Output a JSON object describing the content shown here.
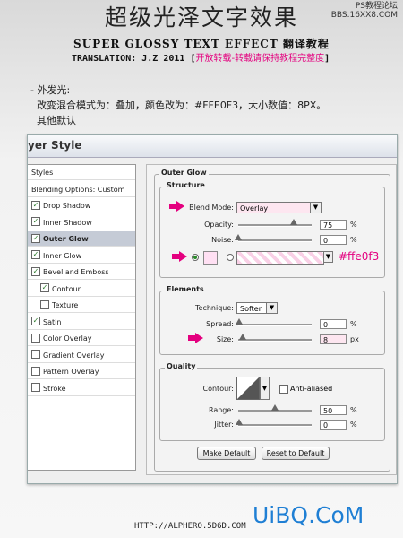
{
  "header": {
    "title": "超级光泽文字效果",
    "subtitle": "SUPER GLOSSY TEXT EFFECT 翻译教程",
    "translation_prefix": "TRANSLATION: J.Z  2011 [",
    "translation_note": "开放转载-转载请保持教程完整度",
    "translation_suffix": "]",
    "watermark": "PS教程论坛\nBBS.16XX8.COM"
  },
  "notes": {
    "line1": "- 外发光:",
    "line2": "  改变混合模式为：叠加，颜色改为：#FFE0F3，大小数值：8PX。",
    "line3": "  其他默认"
  },
  "dialog": {
    "title": "yer Style",
    "left_items": [
      {
        "label": "Styles",
        "checkbox": false
      },
      {
        "label": "Blending Options: Custom",
        "checkbox": false
      },
      {
        "label": "Drop Shadow",
        "checkbox": true,
        "checked": true
      },
      {
        "label": "Inner Shadow",
        "checkbox": true,
        "checked": true
      },
      {
        "label": "Outer Glow",
        "checkbox": true,
        "checked": true,
        "selected": true
      },
      {
        "label": "Inner Glow",
        "checkbox": true,
        "checked": true
      },
      {
        "label": "Bevel and Emboss",
        "checkbox": true,
        "checked": true
      },
      {
        "label": "Contour",
        "checkbox": true,
        "checked": true,
        "indent": true
      },
      {
        "label": "Texture",
        "checkbox": true,
        "checked": false,
        "indent": true
      },
      {
        "label": "Satin",
        "checkbox": true,
        "checked": true
      },
      {
        "label": "Color Overlay",
        "checkbox": true,
        "checked": false
      },
      {
        "label": "Gradient Overlay",
        "checkbox": true,
        "checked": false
      },
      {
        "label": "Pattern Overlay",
        "checkbox": true,
        "checked": false
      },
      {
        "label": "Stroke",
        "checkbox": true,
        "checked": false
      }
    ],
    "panel_title": "Outer Glow",
    "structure": {
      "label": "Structure",
      "blend_mode_label": "Blend Mode:",
      "blend_mode_value": "Overlay",
      "opacity_label": "Opacity:",
      "opacity_value": "75",
      "opacity_level": 0.75,
      "noise_label": "Noise:",
      "noise_value": "0",
      "noise_level": 0,
      "percent": "%",
      "color_hex": "#ffe0f3",
      "color_swatch": "#ffe0f3"
    },
    "elements": {
      "label": "Elements",
      "technique_label": "Technique:",
      "technique_value": "Softer",
      "spread_label": "Spread:",
      "spread_value": "0",
      "size_label": "Size:",
      "size_value": "8",
      "px": "px"
    },
    "quality": {
      "label": "Quality",
      "contour_label": "Contour:",
      "anti_aliased_label": "Anti-aliased",
      "range_label": "Range:",
      "range_value": "50",
      "range_level": 0.5,
      "jitter_label": "Jitter:",
      "jitter_value": "0"
    },
    "make_default": "Make Default",
    "reset_default": "Reset to Default"
  },
  "footer": {
    "url": "HTTP://ALPHERO.5D6D.COM",
    "logo": "UiBQ.CoM"
  },
  "colors": {
    "accent_pink": "#e4007f",
    "logo_blue": "#1f7fd4"
  }
}
